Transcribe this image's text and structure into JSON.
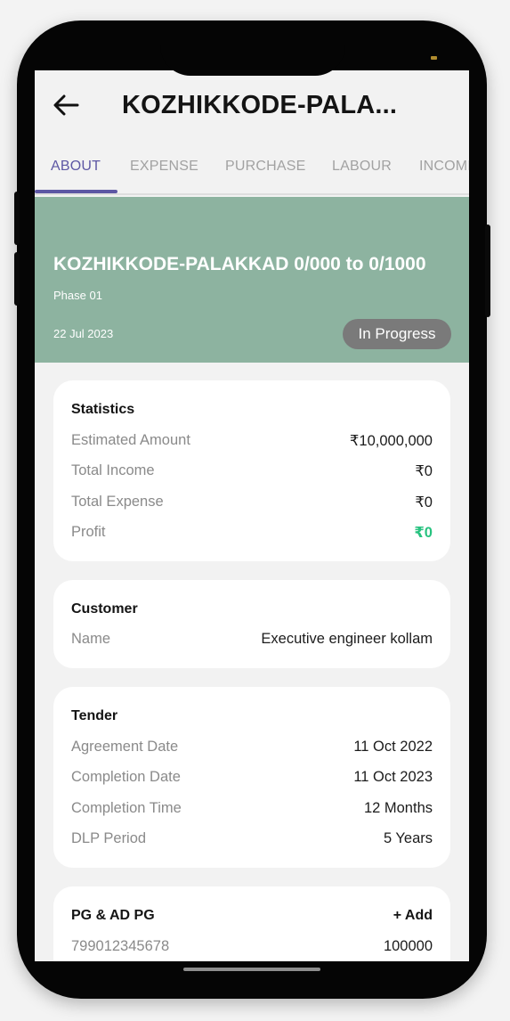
{
  "appbar": {
    "title": "KOZHIKKODE-PALA..."
  },
  "tabs": [
    {
      "label": "ABOUT"
    },
    {
      "label": "EXPENSE"
    },
    {
      "label": "PURCHASE"
    },
    {
      "label": "LABOUR"
    },
    {
      "label": "INCOME"
    }
  ],
  "project": {
    "title": "KOZHIKKODE-PALAKKAD 0/000 to 0/1000",
    "phase": "Phase 01",
    "date": "22 Jul 2023",
    "status": "In Progress"
  },
  "statistics": {
    "title": "Statistics",
    "rows": [
      {
        "label": "Estimated Amount",
        "value": "₹10,000,000"
      },
      {
        "label": "Total Income",
        "value": "₹0"
      },
      {
        "label": "Total Expense",
        "value": "₹0"
      },
      {
        "label": "Profit",
        "value": "₹0"
      }
    ]
  },
  "customer": {
    "title": "Customer",
    "rows": [
      {
        "label": "Name",
        "value": "Executive engineer kollam"
      }
    ]
  },
  "tender": {
    "title": "Tender",
    "rows": [
      {
        "label": "Agreement Date",
        "value": "11 Oct 2022"
      },
      {
        "label": "Completion Date",
        "value": "11 Oct 2023"
      },
      {
        "label": "Completion Time",
        "value": "12 Months"
      },
      {
        "label": "DLP Period",
        "value": "5 Years"
      }
    ]
  },
  "pg": {
    "title": "PG & AD PG",
    "add_label": "+ Add",
    "rows": [
      {
        "label": "799012345678",
        "value": "100000"
      }
    ]
  },
  "colors": {
    "accent": "#5d57a4",
    "hero_background": "#8db3a0",
    "status_badge": "#7a7a7a",
    "profit": "#27c27f"
  }
}
